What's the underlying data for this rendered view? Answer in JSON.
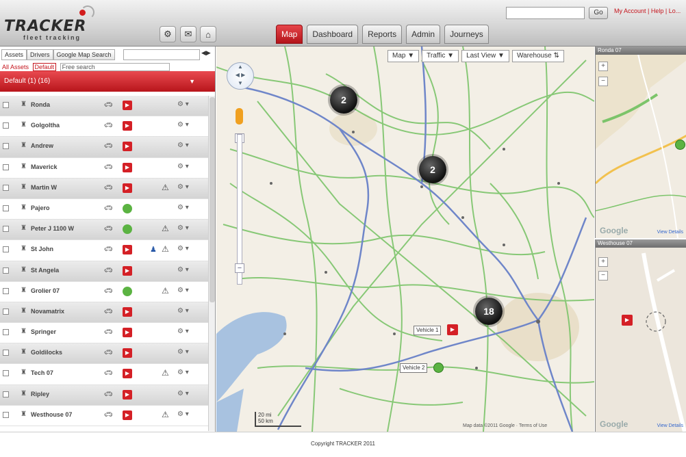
{
  "header": {
    "logo_text": "TRACKER",
    "logo_sub": "fleet tracking",
    "icons": [
      "gear-icon",
      "mail-icon",
      "home-icon"
    ],
    "search_value": "",
    "go_label": "Go",
    "account_links": "My Account | Help | Lo..."
  },
  "nav": {
    "tabs": [
      {
        "label": "Map",
        "active": true
      },
      {
        "label": "Dashboard",
        "active": false
      },
      {
        "label": "Reports",
        "active": false
      },
      {
        "label": "Admin",
        "active": false
      },
      {
        "label": "Journeys",
        "active": false
      }
    ]
  },
  "sidebar": {
    "tabs": [
      "Assets",
      "Drivers",
      "Google Map Search"
    ],
    "collapse_icon": "collapse-icon",
    "filter": {
      "label": "All Assets",
      "select": "Default",
      "input_placeholder": "Free search"
    },
    "group": {
      "label": "Default (1) (16)"
    },
    "rows": [
      {
        "name": "Ronda",
        "status": "stop",
        "alert": false
      },
      {
        "name": "Golgoltha",
        "status": "stop",
        "alert": false
      },
      {
        "name": "Andrew",
        "status": "stop",
        "alert": false
      },
      {
        "name": "Maverick",
        "status": "stop",
        "alert": false
      },
      {
        "name": "Martin W",
        "status": "stop",
        "alert": true
      },
      {
        "name": "Pajero",
        "status": "move",
        "alert": false
      },
      {
        "name": "Peter J 1100 W",
        "status": "move",
        "alert": true
      },
      {
        "name": "St John",
        "status": "stop",
        "alert": true,
        "person": true
      },
      {
        "name": "St Angela",
        "status": "stop",
        "alert": false
      },
      {
        "name": "Grolier 07",
        "status": "move",
        "alert": true
      },
      {
        "name": "Novamatrix",
        "status": "stop",
        "alert": false
      },
      {
        "name": "Springer",
        "status": "stop",
        "alert": false
      },
      {
        "name": "Goldilocks",
        "status": "stop",
        "alert": false
      },
      {
        "name": "Tech 07",
        "status": "stop",
        "alert": true
      },
      {
        "name": "Ripley",
        "status": "stop",
        "alert": false
      },
      {
        "name": "Westhouse 07",
        "status": "stop",
        "alert": true
      }
    ]
  },
  "map": {
    "dropdowns": [
      "Map",
      "Traffic",
      "Last View",
      "Warehouse"
    ],
    "clusters": [
      "2",
      "2",
      "18"
    ],
    "labels": [
      "Vehicle 1",
      "Vehicle 2"
    ],
    "scale": [
      "20 mi",
      "50 km"
    ],
    "copyright": "Map data ©2011 Google · Terms of Use"
  },
  "right_panels": {
    "top_title": "Ronda 07",
    "bottom_title": "Westhouse 07",
    "google_label": "Google",
    "link_label": "View Details"
  },
  "footer": {
    "copyright": "Copyright TRACKER 2011"
  },
  "colors": {
    "accent_red": "#c4141c",
    "moving_green": "#5bb342",
    "stopped_red": "#d42026"
  }
}
